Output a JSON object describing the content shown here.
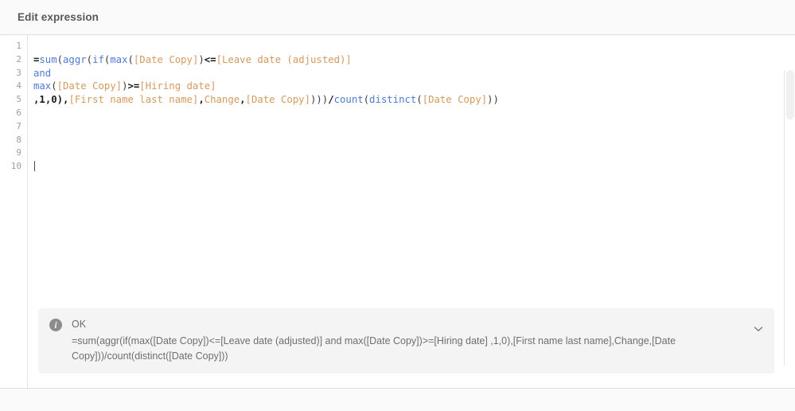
{
  "dialog": {
    "title": "Edit expression"
  },
  "editor": {
    "gutter_lines": [
      "1",
      "2",
      "3",
      "4",
      "5",
      "6",
      "7",
      "8",
      "9",
      "10"
    ],
    "cursor_line": 10,
    "lines": [
      {
        "n": 1,
        "tokens": []
      },
      {
        "n": 2,
        "tokens": [
          {
            "t": "=",
            "c": "op"
          },
          {
            "t": "sum",
            "c": "fn"
          },
          {
            "t": "(",
            "c": "plain"
          },
          {
            "t": "aggr",
            "c": "fn"
          },
          {
            "t": "(",
            "c": "plain"
          },
          {
            "t": "if",
            "c": "fn"
          },
          {
            "t": "(",
            "c": "plain"
          },
          {
            "t": "max",
            "c": "fn"
          },
          {
            "t": "(",
            "c": "plain"
          },
          {
            "t": "[Date Copy]",
            "c": "field"
          },
          {
            "t": ")",
            "c": "plain"
          },
          {
            "t": "<=",
            "c": "op"
          },
          {
            "t": "[Leave date (adjusted)]",
            "c": "field"
          }
        ]
      },
      {
        "n": 3,
        "tokens": [
          {
            "t": "and",
            "c": "fn"
          }
        ]
      },
      {
        "n": 4,
        "tokens": [
          {
            "t": "max",
            "c": "fn"
          },
          {
            "t": "(",
            "c": "plain"
          },
          {
            "t": "[Date Copy]",
            "c": "field"
          },
          {
            "t": ")",
            "c": "plain"
          },
          {
            "t": ">=",
            "c": "op"
          },
          {
            "t": "[Hiring date]",
            "c": "field"
          }
        ]
      },
      {
        "n": 5,
        "tokens": [
          {
            "t": ",",
            "c": "op"
          },
          {
            "t": "1",
            "c": "num"
          },
          {
            "t": ",",
            "c": "op"
          },
          {
            "t": "0",
            "c": "num"
          },
          {
            "t": "),",
            "c": "op"
          },
          {
            "t": "[First name last name]",
            "c": "field"
          },
          {
            "t": ",",
            "c": "op"
          },
          {
            "t": "Change",
            "c": "field"
          },
          {
            "t": ",",
            "c": "op"
          },
          {
            "t": "[Date Copy]",
            "c": "field"
          },
          {
            "t": ")))",
            "c": "plain"
          },
          {
            "t": "/",
            "c": "op"
          },
          {
            "t": "count",
            "c": "fn"
          },
          {
            "t": "(",
            "c": "plain"
          },
          {
            "t": "distinct",
            "c": "fn"
          },
          {
            "t": "(",
            "c": "plain"
          },
          {
            "t": "[Date Copy]",
            "c": "field"
          },
          {
            "t": "))",
            "c": "plain"
          }
        ]
      },
      {
        "n": 6,
        "tokens": []
      },
      {
        "n": 7,
        "tokens": []
      },
      {
        "n": 8,
        "tokens": []
      },
      {
        "n": 9,
        "tokens": []
      },
      {
        "n": 10,
        "tokens": []
      }
    ]
  },
  "info_panel": {
    "icon": "info-icon",
    "status": "OK",
    "expression": "=sum(aggr(if(max([Date Copy])<=[Leave date (adjusted)] and max([Date Copy])>=[Hiring date] ,1,0),[First name last name],Change,[Date Copy]))/count(distinct([Date Copy]))",
    "collapse_icon": "chevron-down-icon"
  },
  "colors": {
    "function": "#4e7bd4",
    "field": "#d49a5e",
    "plain": "#3b3b3b",
    "panel_background": "#f4f4f4",
    "header_background": "#fafafa"
  }
}
